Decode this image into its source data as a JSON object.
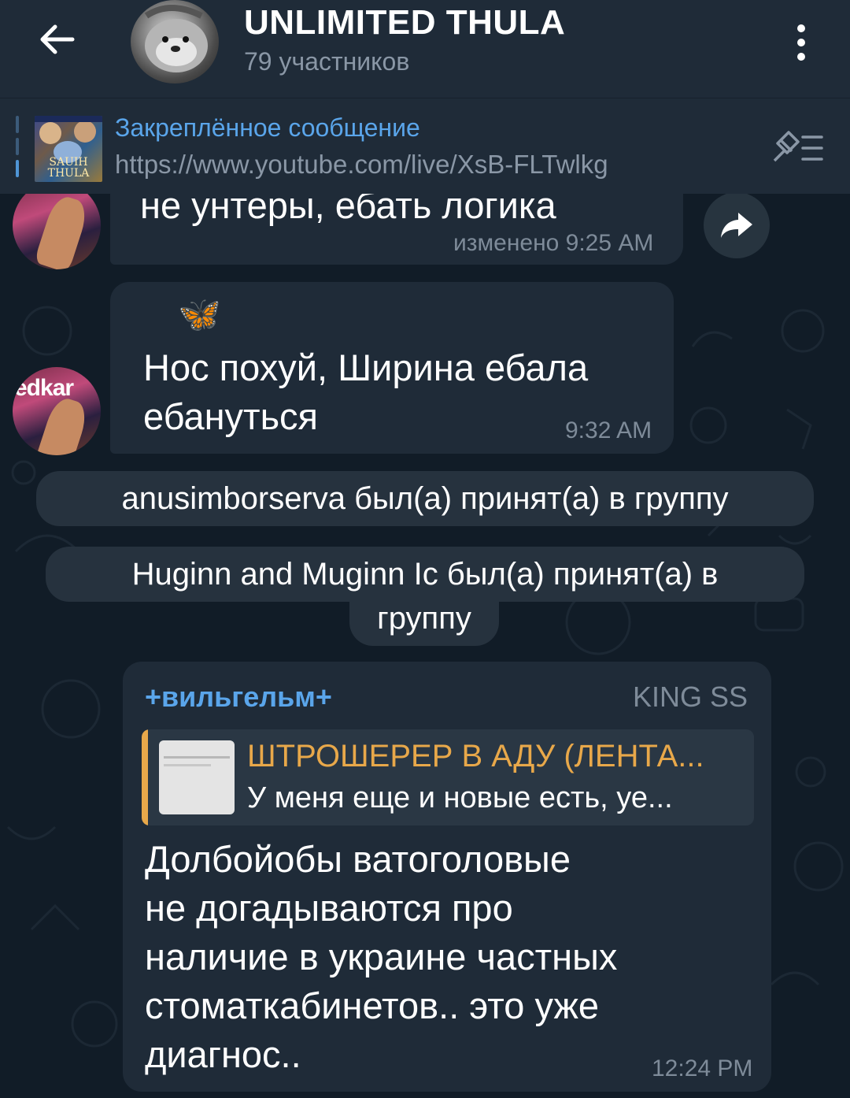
{
  "header": {
    "title": "UNLIMITED THULA",
    "subtitle": "79 участников"
  },
  "pinned": {
    "label": "Закреплённое сообщение",
    "text": "https://www.youtube.com/live/XsB-FLTwlkg",
    "thumb_text": "SAUIH THULA"
  },
  "messages": [
    {
      "text": "не унтеры, ебать логика",
      "time": "изменено 9:25 AM"
    },
    {
      "emoji": "🦋",
      "lines": [
        "Нос похуй, Ширина ебала",
        "ебануться"
      ],
      "time": "9:32 AM"
    },
    {
      "service": "anusimborserva был(а) принят(а) в группу"
    },
    {
      "service_lines": [
        "Huginn and Muginn Ic был(а) принят(а) в",
        "группу"
      ]
    },
    {
      "sender": "+вильгельм+",
      "tag": "KING SS",
      "reply": {
        "title": "ШТРОШЕРЕР В АДУ (ЛЕНТА...",
        "text": "У меня еще и новые есть, уе..."
      },
      "lines": [
        "Долбойобы ватоголовые",
        "не догадываются про",
        "наличие в украине частных",
        "стоматкабинетов.. это уже",
        "диагнос.."
      ],
      "time": "12:24 PM"
    }
  ],
  "avatar_text": "edkar",
  "colors": {
    "header_bg": "#1f2b38",
    "chat_bg": "#111c27",
    "bubble_bg": "#1f2b38",
    "accent": "#5aa5ea",
    "reply_accent": "#e8a84a",
    "muted": "#7e8b99"
  }
}
